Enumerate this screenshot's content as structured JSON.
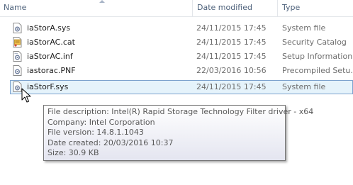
{
  "columns": {
    "name": "Name",
    "date": "Date modified",
    "type": "Type"
  },
  "files": [
    {
      "name": "iaStorA.sys",
      "date": "24/11/2015 17:45",
      "type": "System file",
      "icon": "system-file-icon"
    },
    {
      "name": "iaStorAC.cat",
      "date": "24/11/2015 17:45",
      "type": "Security Catalog",
      "icon": "security-catalog-icon"
    },
    {
      "name": "iaStorAC.inf",
      "date": "24/11/2015 17:45",
      "type": "Setup Information",
      "icon": "setup-information-icon"
    },
    {
      "name": "iastorac.PNF",
      "date": "22/03/2016 10:56",
      "type": "Precompiled Setu...",
      "icon": "precompiled-setup-icon"
    },
    {
      "name": "iaStorF.sys",
      "date": "24/11/2015 17:45",
      "type": "System file",
      "icon": "system-file-icon"
    }
  ],
  "tooltip": {
    "description": "File description: Intel(R) Rapid Storage Technology Filter driver - x64",
    "company": "Company: Intel Corporation",
    "version": "File version: 14.8.1.1043",
    "created": "Date created: 20/03/2016 10:37",
    "size": "Size: 30.9 KB"
  },
  "colors": {
    "hover_bg": "#e5f3fb",
    "hover_border": "#7da2ce",
    "header_text": "#4c607a"
  }
}
